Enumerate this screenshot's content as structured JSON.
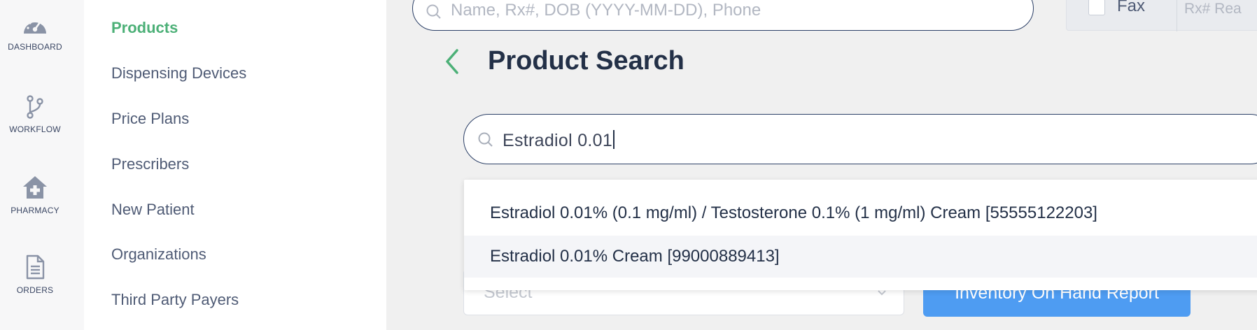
{
  "rail": {
    "items": [
      {
        "label": "DASHBOARD",
        "icon": "dashboard-gauge-icon"
      },
      {
        "label": "WORKFLOW",
        "icon": "workflow-branch-icon"
      },
      {
        "label": "PHARMACY",
        "icon": "pharmacy-house-icon"
      },
      {
        "label": "ORDERS",
        "icon": "orders-document-icon"
      }
    ]
  },
  "subnav": {
    "items": [
      {
        "label": "Products",
        "active": true
      },
      {
        "label": "Dispensing Devices"
      },
      {
        "label": "Price Plans"
      },
      {
        "label": "Prescribers"
      },
      {
        "label": "New Patient"
      },
      {
        "label": "Organizations"
      },
      {
        "label": "Third Party Payers"
      }
    ]
  },
  "header": {
    "search_placeholder": "Name, Rx#, DOB (YYYY-MM-DD), Phone",
    "fax_label": "Fax",
    "rx_placeholder": "Rx# Rea"
  },
  "page": {
    "title": "Product Search"
  },
  "product_search": {
    "value": "Estradiol 0.01"
  },
  "dropdown": {
    "items": [
      {
        "label": "Estradiol 0.01% (0.1 mg/ml) / Testosterone 0.1% (1 mg/ml) Cream [55555122203]"
      },
      {
        "label": "Estradiol 0.01% Cream [99000889413]",
        "hovered": true
      }
    ]
  },
  "filters": {
    "select_placeholder": "Select",
    "report_button": "Inventory On Hand Report"
  },
  "colors": {
    "accent_green": "#4cb077",
    "navy": "#233047",
    "button_blue": "#4e9cf2"
  }
}
